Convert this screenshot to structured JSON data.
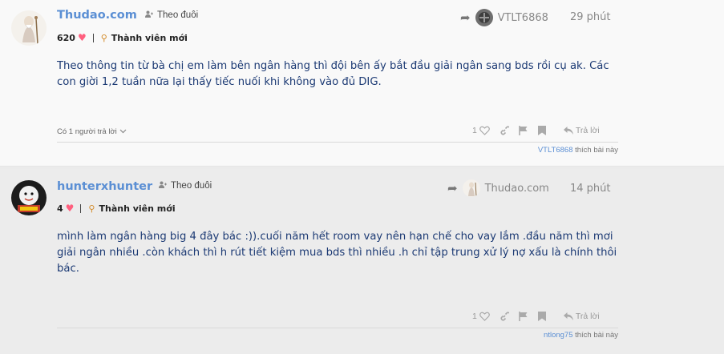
{
  "posts": [
    {
      "username": "Thudao.com",
      "follow_label": "Theo đuôi",
      "points": "620",
      "rank": "Thành viên mới",
      "reply_to_user": "VTLT6868",
      "time": "29 phút",
      "text": "Theo thông tin từ bà chị em làm bên ngân hàng thì đội bên ấy bắt đầu giải ngân sang bds rồi cụ ak. Các con giời 1,2 tuần nữa lại thấy tiếc nuối khi không vào đủ DIG.",
      "replies_toggle": "Có 1 người trả lời",
      "like_count": "1",
      "reply_label": "Trả lời",
      "liked_by": "VTLT6868",
      "liked_suffix": "thích bài này"
    },
    {
      "username": "hunterxhunter",
      "follow_label": "Theo đuôi",
      "points": "4",
      "rank": "Thành viên mới",
      "reply_to_user": "Thudao.com",
      "time": "14 phút",
      "text": "mình làm ngân hàng big 4 đây bác :)).cuối năm hết room vay nên hạn chế cho vay lắm .đầu năm thì mơi giải ngân nhiều .còn khách thì h rút tiết kiệm mua bds thì nhiều .h chỉ tập trung xử lý nợ xấu là chính thôi bác.",
      "like_count": "1",
      "reply_label": "Trả lời",
      "liked_by": "ntlong75",
      "liked_suffix": "thích bài này"
    }
  ],
  "icons": {
    "follow": "person-plus-icon",
    "heart": "heart-icon",
    "rank": "rank-badge-icon",
    "reply_arrow": "reply-arrow-icon",
    "like": "heart-outline-icon",
    "link": "link-icon",
    "flag": "flag-icon",
    "bookmark": "bookmark-icon",
    "reply": "reply-icon",
    "chevron": "chevron-down-icon"
  },
  "colors": {
    "username": "#5b8fd4",
    "body_text": "#1c3a74",
    "heart": "#ff5f7e",
    "rank": "#d38b2a"
  }
}
